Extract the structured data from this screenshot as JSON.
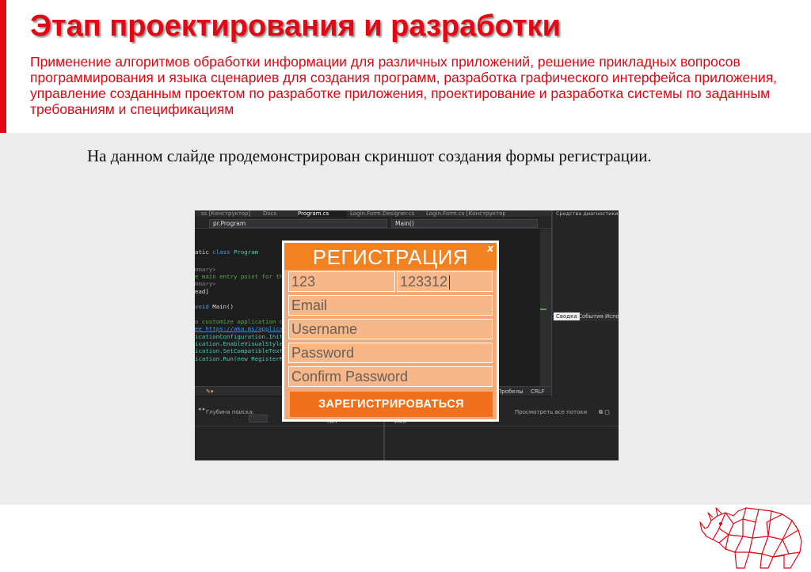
{
  "slide": {
    "title": "Этап проектирования и разработки",
    "subtitle": "Применение алгоритмов обработки информации для различных приложений, решение прикладных вопросов программирования и языка сценариев для создания программ, разработка графического интерфейса приложения, управление созданным проектом по разработке приложения, проектирование и разработка системы по заданным требованиям и спецификациям",
    "caption": "На данном слайде продемонстрирован скриншот создания формы регистрации."
  },
  "ide": {
    "tabs": [
      "ss [Конструктор]",
      "Docs",
      "Program.cs",
      "Login.Form.Designer.cs",
      "Login.Form.cs [Конструктор]"
    ],
    "dropdowns": [
      "pr.Program",
      "Main()"
    ],
    "code": [
      {
        "prefix": "atic ",
        "kw": "class",
        "rest": " ",
        "ty": "Program"
      },
      {
        "text": "mmary>"
      },
      {
        "text": "e main entry point for the"
      },
      {
        "text": "mmary>"
      },
      {
        "text": "ead]"
      },
      {
        "kw": "void",
        "rest": " Main()"
      },
      {
        "text": "o customize application c"
      },
      {
        "text": "ee https://aka.ms/applica"
      },
      {
        "text": "icationConfiguration.Init"
      },
      {
        "text": "ication.EnableVisualStyle"
      },
      {
        "text": "ication.SetCompatibleText"
      },
      {
        "text": "ication.Run(new RegisterF"
      }
    ],
    "right_panel_title": "Средства диагностики",
    "right_tabs": [
      "Сводка",
      "События",
      "Испо"
    ],
    "status": [
      "Пробелы",
      "CRLF"
    ],
    "bottom": {
      "search_depth": "Глубина поиска:",
      "show_threads": "Просмотреть все потоки",
      "col_type": "Тип",
      "col_name": "Имя"
    }
  },
  "form": {
    "title": "РЕГИСТРАЦИЯ",
    "close": "x",
    "first_name": "123",
    "last_name": "123312",
    "email_placeholder": "Email",
    "username_placeholder": "Username",
    "password_placeholder": "Password",
    "confirm_placeholder": "Confirm Password",
    "submit": "ЗАРЕГИСТРИРОВАТЬСЯ"
  },
  "colors": {
    "brand_red": "#e30613",
    "form_orange": "#f28121",
    "field_peach": "#f7b788",
    "button_orange": "#f26f1b"
  },
  "icons": [
    "rhino-logo"
  ]
}
